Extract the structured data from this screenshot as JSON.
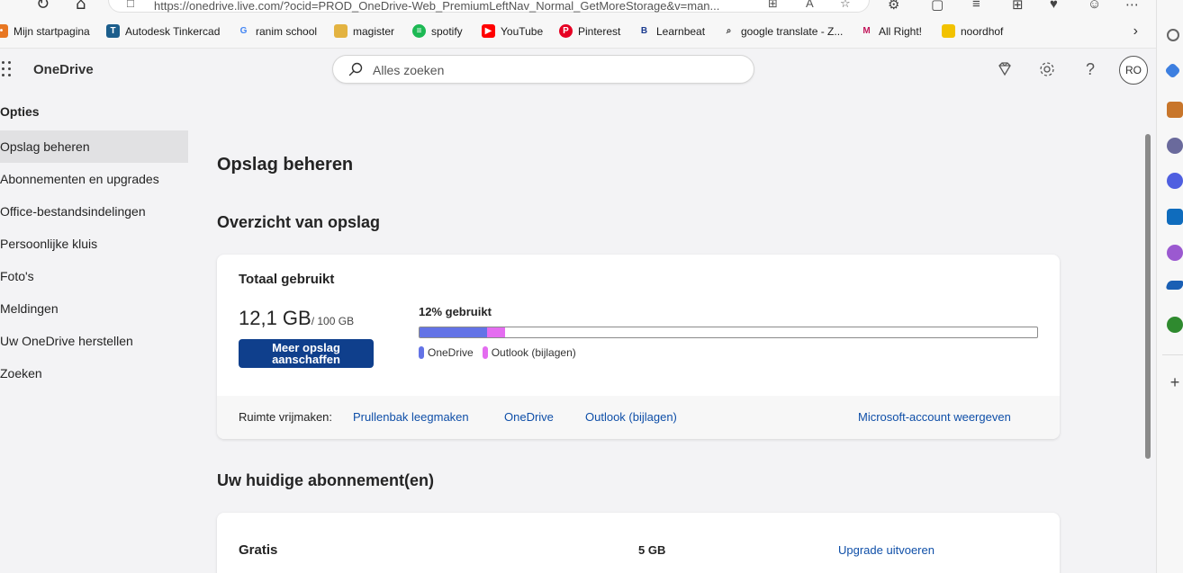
{
  "browser": {
    "url": "https://onedrive.live.com/?ocid=PROD_OneDrive-Web_PremiumLeftNav_Normal_GetMoreStorage&v=man...",
    "bookmarks": [
      {
        "label": "Mijn startpagina",
        "icon": "home-page-icon",
        "color": "#e87722"
      },
      {
        "label": "Autodesk Tinkercad",
        "icon": "tinkercad-icon",
        "color": "#1c5e8c"
      },
      {
        "label": "ranim school",
        "icon": "google-icon",
        "color": "#4285f4"
      },
      {
        "label": "magister",
        "icon": "folder-icon",
        "color": "#e3b341"
      },
      {
        "label": "spotify",
        "icon": "spotify-icon",
        "color": "#1db954"
      },
      {
        "label": "YouTube",
        "icon": "youtube-icon",
        "color": "#ff0000"
      },
      {
        "label": "Pinterest",
        "icon": "pinterest-icon",
        "color": "#e60023"
      },
      {
        "label": "Learnbeat",
        "icon": "learnbeat-icon",
        "color": "#1b3b8f"
      },
      {
        "label": "google translate - Z...",
        "icon": "search-icon",
        "color": "#333333"
      },
      {
        "label": "All Right!",
        "icon": "allright-icon",
        "color": "#c2185b"
      },
      {
        "label": "noordhof",
        "icon": "noordhof-icon",
        "color": "#f2c200"
      }
    ]
  },
  "header": {
    "app_name": "OneDrive",
    "search_placeholder": "Alles zoeken",
    "avatar_initials": "RO"
  },
  "sidebar": {
    "title": "Opties",
    "items": [
      {
        "label": "Opslag beheren",
        "active": true
      },
      {
        "label": "Abonnementen en upgrades",
        "active": false
      },
      {
        "label": "Office-bestandsindelingen",
        "active": false
      },
      {
        "label": "Persoonlijke kluis",
        "active": false
      },
      {
        "label": "Foto's",
        "active": false
      },
      {
        "label": "Meldingen",
        "active": false
      },
      {
        "label": "Uw OneDrive herstellen",
        "active": false
      },
      {
        "label": "Zoeken",
        "active": false
      }
    ]
  },
  "main": {
    "page_title": "Opslag beheren",
    "overview_title": "Overzicht van opslag",
    "storage": {
      "card_title": "Totaal gebruikt",
      "used_amount": "12,1 GB",
      "total_amount": "/ 100 GB",
      "buy_button": "Meer opslag aanschaffen",
      "percent_label": "12% gebruikt",
      "segments": [
        {
          "name": "OneDrive",
          "fraction": 0.11,
          "color": "#6373e6"
        },
        {
          "name": "Outlook (bijlagen)",
          "fraction": 0.028,
          "color": "#e46df0"
        }
      ],
      "free_up_label": "Ruimte vrijmaken:",
      "free_up_links": [
        "Prullenbak leegmaken",
        "OneDrive",
        "Outlook (bijlagen)"
      ],
      "account_link": "Microsoft-account weergeven"
    },
    "subscriptions_title": "Uw huidige abonnement(en)",
    "plan": {
      "name": "Gratis",
      "size": "5 GB",
      "action": "Upgrade uitvoeren"
    }
  }
}
